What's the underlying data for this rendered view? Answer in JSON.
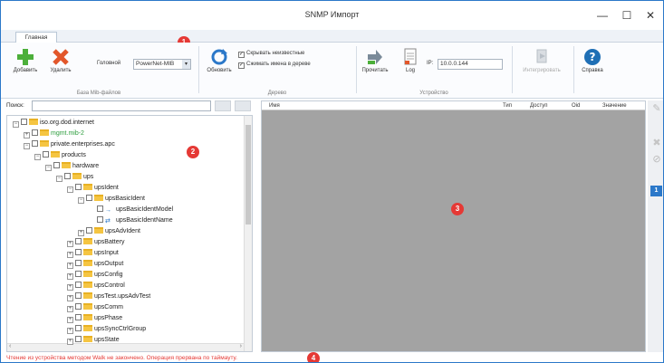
{
  "window": {
    "title": "SNMP Импорт",
    "minimize_icon": "—",
    "maximize_icon": "☐",
    "close_icon": "✕"
  },
  "tabs": [
    {
      "label": "Главная"
    }
  ],
  "ribbon": {
    "mib_group": {
      "add_label": "Добавить",
      "delete_label": "Удалить",
      "top_label": "Головной",
      "top_value": "PowerNet-MIB",
      "group_label": "База Mib-файлов"
    },
    "tree_group": {
      "refresh_label": "Обновить",
      "hide_unknown": "Скрывать неизвестные",
      "collapse_names": "Сжимать имена в дереве",
      "group_label": "Дерево"
    },
    "device_group": {
      "read_label": "Прочитать",
      "log_label": "Log",
      "ip_label": "IP:",
      "ip_value": "10.0.0.144",
      "group_label": "Устройство"
    },
    "integrate_label": "Интегрировать",
    "help_label": "Справка"
  },
  "search": {
    "label": "Поиск:",
    "value": ""
  },
  "tree": [
    {
      "label": "iso.org.dod.internet",
      "exp": "−",
      "color": "#222222"
    },
    {
      "label": "mgmt.mib-2",
      "exp": "+",
      "color": "#2e9e3e"
    },
    {
      "label": "private.enterprises.apc",
      "exp": "−",
      "color": "#222222"
    },
    {
      "label": "products",
      "exp": "−",
      "color": "#222222"
    },
    {
      "label": "hardware",
      "exp": "−",
      "color": "#222222"
    },
    {
      "label": "ups",
      "exp": "−",
      "color": "#222222"
    },
    {
      "label": "upsIdent",
      "exp": "−",
      "color": "#222222"
    },
    {
      "label": "upsBasicIdent",
      "exp": "−",
      "color": "#222222"
    },
    {
      "label": "upsBasicIdentModel",
      "exp": "",
      "color": "#222222"
    },
    {
      "label": "upsBasicIdentName",
      "exp": "",
      "color": "#222222"
    },
    {
      "label": "upsAdvIdent",
      "exp": "+",
      "color": "#222222"
    },
    {
      "label": "upsBattery",
      "exp": "+",
      "color": "#222222"
    },
    {
      "label": "upsInput",
      "exp": "+",
      "color": "#222222"
    },
    {
      "label": "upsOutput",
      "exp": "+",
      "color": "#222222"
    },
    {
      "label": "upsConfig",
      "exp": "+",
      "color": "#222222"
    },
    {
      "label": "upsControl",
      "exp": "+",
      "color": "#222222"
    },
    {
      "label": "upsTest.upsAdvTest",
      "exp": "+",
      "color": "#222222"
    },
    {
      "label": "upsComm",
      "exp": "+",
      "color": "#222222"
    },
    {
      "label": "upsPhase",
      "exp": "+",
      "color": "#222222"
    },
    {
      "label": "upsSyncCtrlGroup",
      "exp": "+",
      "color": "#222222"
    },
    {
      "label": "upsState",
      "exp": "+",
      "color": "#222222"
    }
  ],
  "table": {
    "columns": [
      "Имя",
      "Тип",
      "Доступ",
      "Oid",
      "Значение"
    ]
  },
  "side": {
    "count": "1"
  },
  "badges": [
    "1",
    "2",
    "3",
    "4"
  ],
  "status": {
    "message": "Чтение из устройства методом Walk не закончено. Операция прервана по таймауту."
  }
}
